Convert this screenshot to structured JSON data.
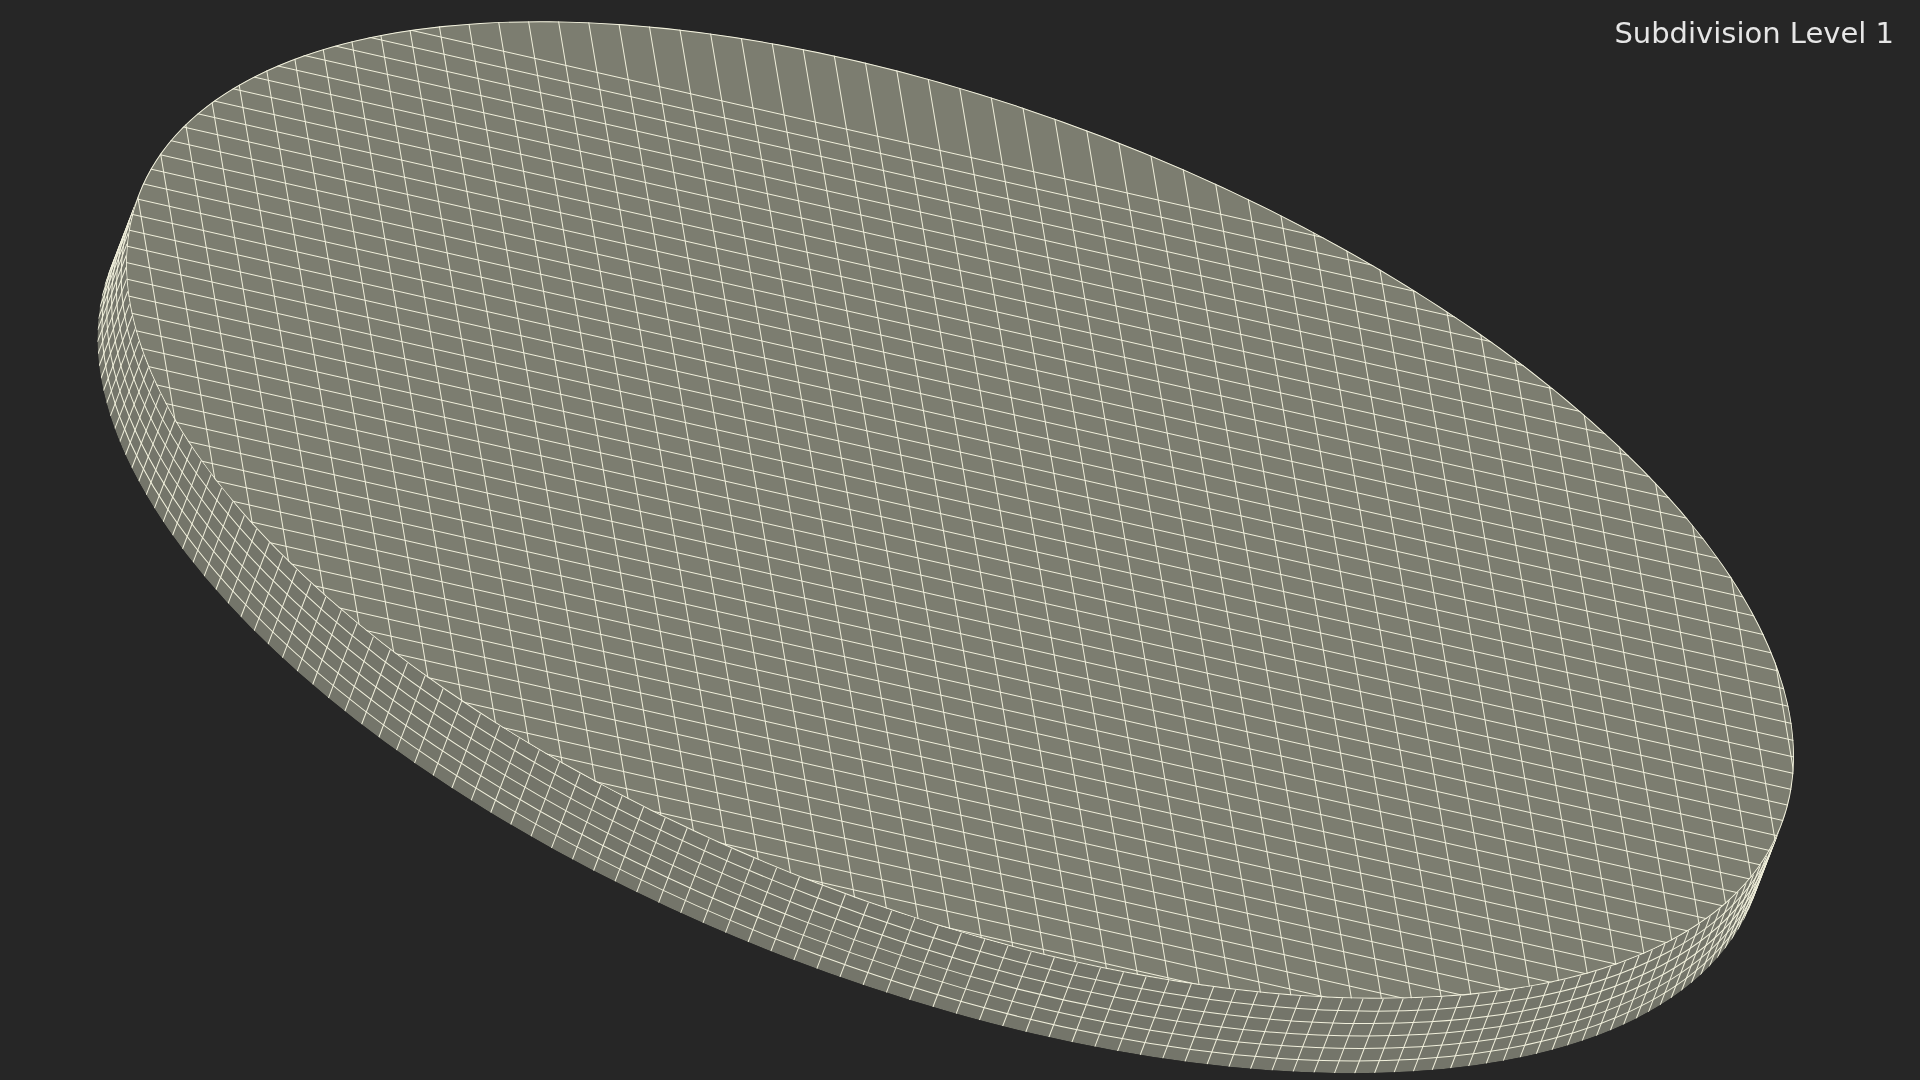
{
  "viewport_label": "Subdivision Level 1"
}
